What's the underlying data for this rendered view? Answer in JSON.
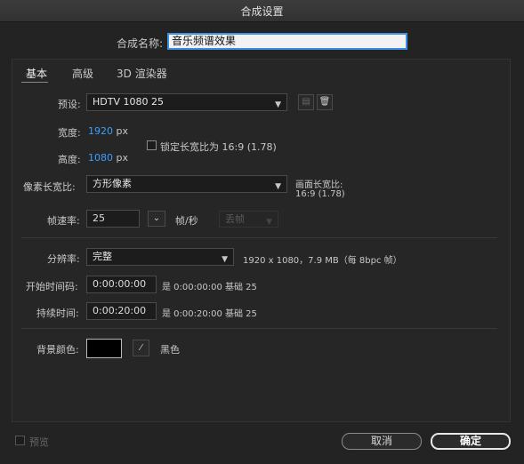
{
  "window": {
    "title": "合成设置"
  },
  "comp_name": {
    "label": "合成名称:",
    "value": "音乐频谱效果"
  },
  "tabs": [
    {
      "label": "基本",
      "active": true
    },
    {
      "label": "高级"
    },
    {
      "label": "3D 渲染器"
    }
  ],
  "preset": {
    "label": "预设:",
    "value": "HDTV 1080 25"
  },
  "width": {
    "label": "宽度:",
    "value": "1920",
    "unit": "px"
  },
  "height": {
    "label": "高度:",
    "value": "1080",
    "unit": "px"
  },
  "lock_aspect": {
    "label": "锁定长宽比为 16:9 (1.78)",
    "checked": false
  },
  "pixel_aspect": {
    "label": "像素长宽比:",
    "value": "方形像素"
  },
  "frame_aspect": {
    "label": "画面长宽比:",
    "value": "16:9 (1.78)"
  },
  "frame_rate": {
    "label": "帧速率:",
    "value": "25",
    "unit": "帧/秒",
    "drop_frame": "丢帧"
  },
  "resolution": {
    "label": "分辨率:",
    "value": "完整",
    "info": "1920 x 1080，7.9 MB（每 8bpc 帧）"
  },
  "start_timecode": {
    "label": "开始时间码:",
    "value": "0:00:00:00",
    "info": "是 0:00:00:00  基础 25"
  },
  "duration": {
    "label": "持续时间:",
    "value": "0:00:20:00",
    "info": "是 0:00:20:00  基础 25"
  },
  "background": {
    "label": "背景颜色:",
    "color": "#000000",
    "name": "黑色"
  },
  "footer": {
    "preview_label": "预览",
    "cancel": "取消",
    "ok": "确定"
  },
  "colors": {
    "accent": "#3aa0ff",
    "focus": "#3d8fe0"
  }
}
